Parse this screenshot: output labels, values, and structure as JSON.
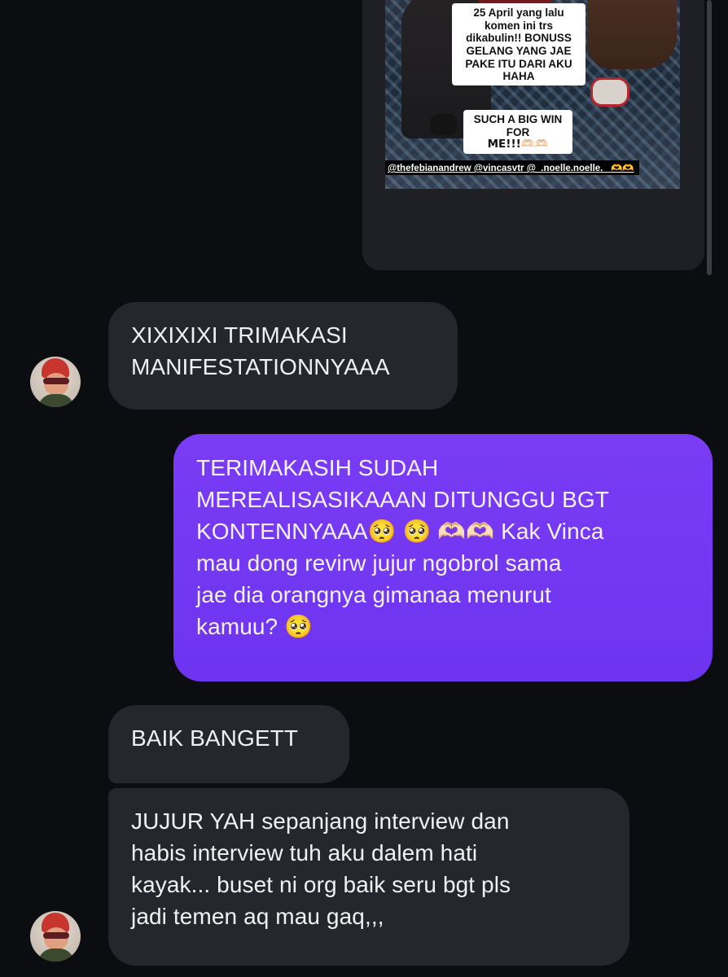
{
  "shared_story": {
    "sticker_main_lines": [
      "25 April yang lalu",
      "komen ini trs",
      "dikabulin!! BONUSS",
      "GELANG YANG JAE",
      "PAKE ITU DARI AKU",
      "HAHA"
    ],
    "sticker_sub_lines": [
      "SUCH A BIG WIN FOR",
      "ME!!!🫶🏻🫶🏻"
    ],
    "mentions": "@thefebianandrew @vincasvtr @_.noelle.noelle._",
    "mentions_hearts": "🫶🫶"
  },
  "messages": [
    {
      "direction": "incoming",
      "text": "XIXIXIXI TRIMAKASI\nMANIFESTATIONNYAAA"
    },
    {
      "direction": "outgoing",
      "text": "TERIMAKASIH SUDAH\nMEREALISASIKAAAN DITUNGGU BGT\nKONTENNYAAA🥺 🥺 🫶🏻🫶🏻 Kak Vinca\nmau dong revirw jujur ngobrol sama\njae dia orangnya gimanaa menurut\nkamuu? 🥺"
    },
    {
      "direction": "incoming",
      "text": "BAIK BANGETT"
    },
    {
      "direction": "incoming",
      "text": "JUJUR YAH sepanjang interview dan\nhabis interview tuh aku dalem hati\nkayak... buset ni org baik seru bgt pls\njadi temen aq mau gaq,,,"
    }
  ],
  "theme": {
    "background": "#0c0d11",
    "incoming_bubble": "#26272c",
    "outgoing_bubble": "#7136f1"
  },
  "icons": {
    "avatar": "contact-avatar"
  }
}
